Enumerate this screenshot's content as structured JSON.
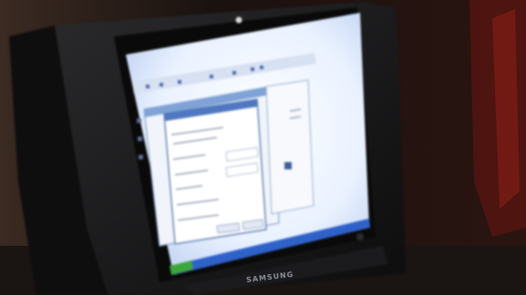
{
  "scene": {
    "description_colors": {
      "wall": "#140e0c",
      "monitor_bezel": "#161616",
      "screen_glow": "#e9f2ff",
      "taskbar": "#2f62c9",
      "window_frame": "#7fa3d6"
    }
  },
  "monitor": {
    "brand": "SAMSUNG"
  },
  "screen": {
    "taskbar_text": ""
  }
}
